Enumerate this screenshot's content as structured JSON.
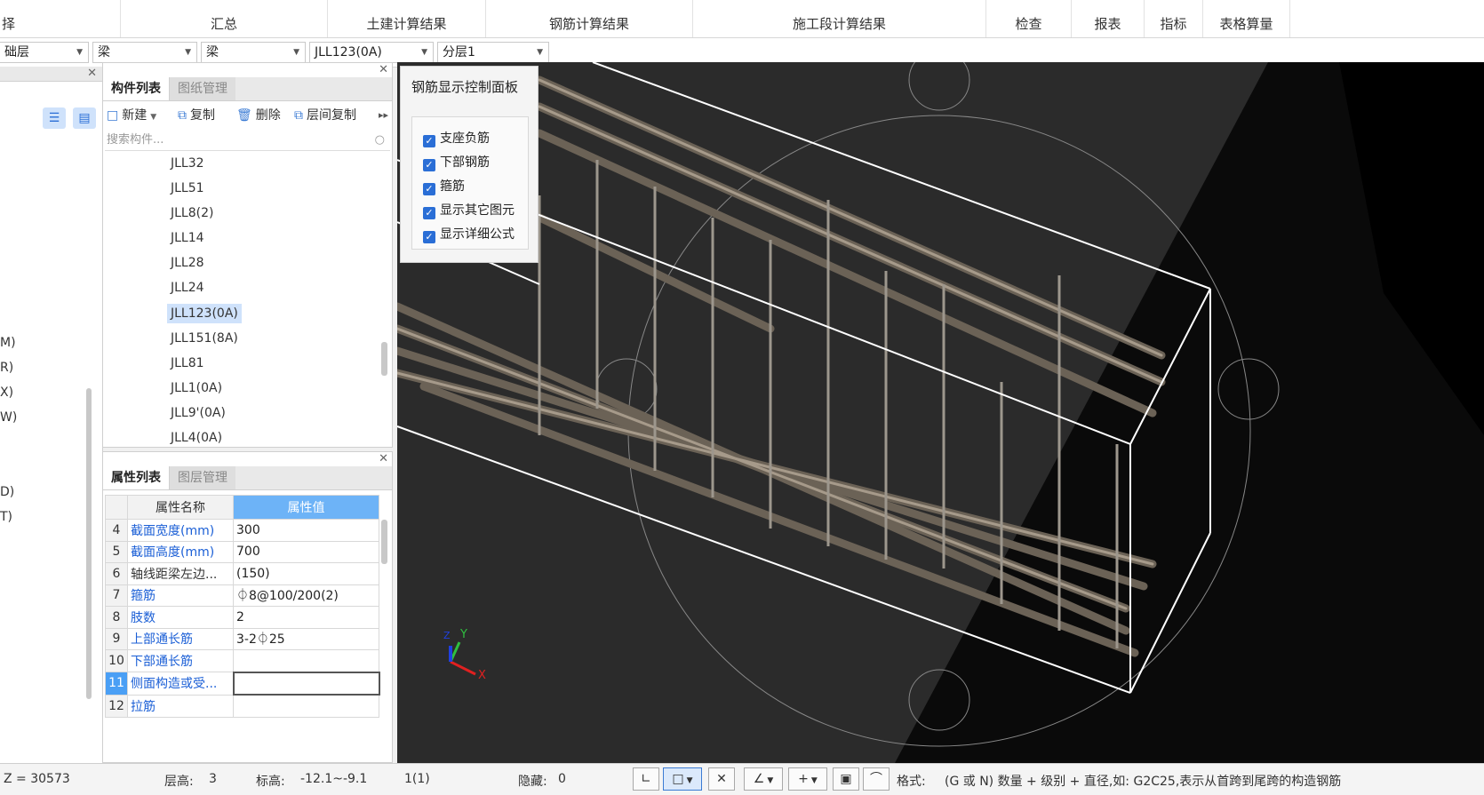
{
  "ribbon": {
    "tabs": [
      "择",
      "汇总",
      "土建计算结果",
      "钢筋计算结果",
      "施工段计算结果",
      "检查",
      "报表",
      "指标",
      "表格算量"
    ]
  },
  "dropdowns": {
    "floor": "础层",
    "type1": "梁",
    "type2": "梁",
    "component": "JLL123(0A)",
    "layer": "分层1"
  },
  "left_strip": {
    "items": [
      "M)",
      "R)",
      "X)",
      "W)",
      "D)",
      "T)"
    ]
  },
  "component_panel": {
    "tab_active": "构件列表",
    "tab_inactive": "图纸管理",
    "toolbar": {
      "new": "新建",
      "copy": "复制",
      "delete": "删除",
      "floor_copy": "层间复制"
    },
    "search_placeholder": "搜索构件...",
    "items": [
      "JLL32",
      "JLL51",
      "JLL8(2)",
      "JLL14",
      "JLL28",
      "JLL24",
      "JLL123(0A)",
      "JLL151(8A)",
      "JLL81",
      "JLL1(0A)",
      "JLL9'(0A)",
      "JLL4(0A)"
    ],
    "selected": "JLL123(0A)"
  },
  "property_panel": {
    "tab_active": "属性列表",
    "tab_inactive": "图层管理",
    "col_name": "属性名称",
    "col_value": "属性值",
    "rows": [
      {
        "num": "4",
        "name": "截面宽度(mm)",
        "value": "300"
      },
      {
        "num": "5",
        "name": "截面高度(mm)",
        "value": "700"
      },
      {
        "num": "6",
        "name": "轴线距梁左边...",
        "value": "(150)"
      },
      {
        "num": "7",
        "name": "箍筋",
        "value": "⏀8@100/200(2)"
      },
      {
        "num": "8",
        "name": "肢数",
        "value": "2"
      },
      {
        "num": "9",
        "name": "上部通长筋",
        "value": "3-2⏀25"
      },
      {
        "num": "10",
        "name": "下部通长筋",
        "value": ""
      },
      {
        "num": "11",
        "name": "侧面构造或受...",
        "value": ""
      },
      {
        "num": "12",
        "name": "拉筋",
        "value": ""
      }
    ]
  },
  "control_panel": {
    "title": "钢筋显示控制面板",
    "options": [
      "支座负筋",
      "下部钢筋",
      "箍筋",
      "显示其它图元",
      "显示详细公式"
    ]
  },
  "axis": {
    "x": "X",
    "y": "Y",
    "z": "Z"
  },
  "status": {
    "z": "Z = 30573",
    "floor_height_label": "层高:",
    "floor_height": "3",
    "elevation_label": "标高:",
    "elevation": "-12.1~-9.1",
    "count": "1(1)",
    "hidden_label": "隐藏:",
    "hidden": "0",
    "format_label": "格式:",
    "format_text": "(G 或 N) 数量 + 级别 + 直径,如:  G2C25,表示从首跨到尾跨的构造钢筋"
  }
}
